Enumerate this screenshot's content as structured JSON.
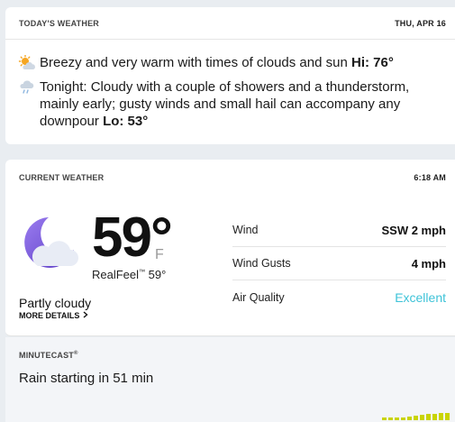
{
  "today": {
    "title": "TODAY'S WEATHER",
    "date": "THU, APR 16",
    "day_icon": "partly-sunny-icon",
    "day_text": "Breezy and very warm with times of clouds and sun ",
    "day_hi_label": "Hi: 76°",
    "night_icon": "cloud-showers-icon",
    "night_text": "Tonight: Cloudy with a couple of showers and a thunderstorm, mainly early; gusty winds and small hail can accompany any downpour ",
    "night_lo_label": "Lo: 53°"
  },
  "current": {
    "title": "CURRENT WEATHER",
    "time": "6:18 AM",
    "icon": "partly-cloudy-night-icon",
    "temperature": "59°",
    "unit": "F",
    "realfeel_label": "RealFeel",
    "realfeel_value": "59°",
    "condition": "Partly cloudy",
    "more_details": "MORE DETAILS",
    "stats": [
      {
        "label": "Wind",
        "value": "SSW 2 mph"
      },
      {
        "label": "Wind Gusts",
        "value": "4 mph"
      },
      {
        "label": "Air Quality",
        "value": "Excellent"
      }
    ],
    "colors": {
      "air_quality_excellent": "#3ec3d8",
      "moon": "#7b5bd6"
    }
  },
  "minutecast": {
    "title": "MINUTECAST",
    "message": "Rain starting in 51 min",
    "bar_color": "#c9d400"
  }
}
